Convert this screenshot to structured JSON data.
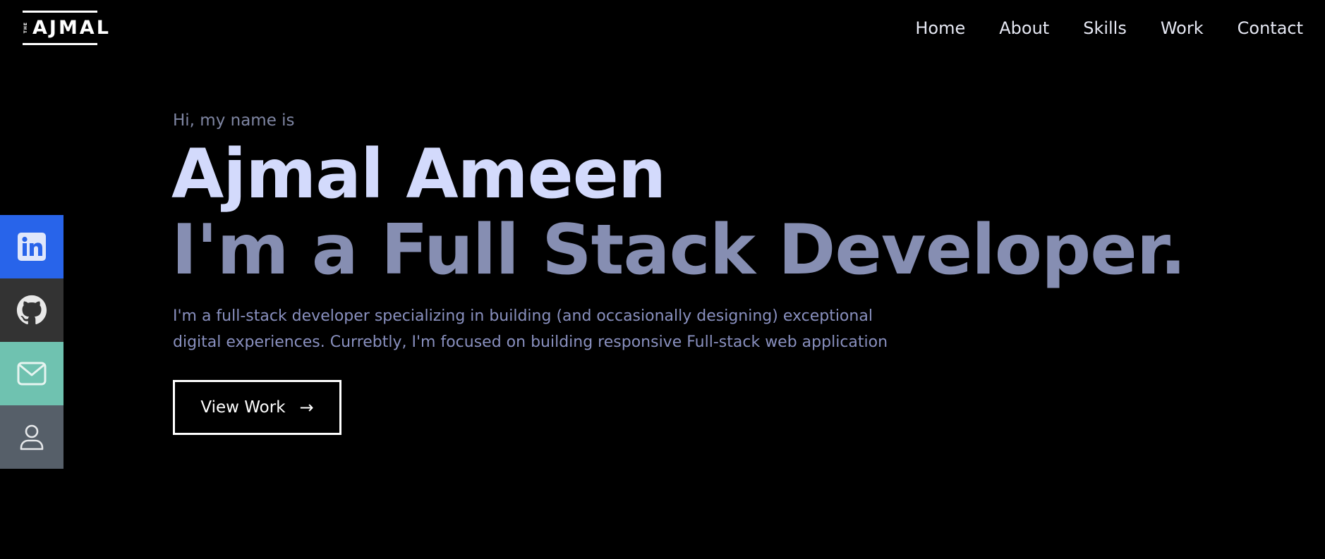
{
  "header": {
    "logo_small": "THE",
    "logo_main": "AJMAL",
    "nav": [
      {
        "label": "Home"
      },
      {
        "label": "About"
      },
      {
        "label": "Skills"
      },
      {
        "label": "Work"
      },
      {
        "label": "Contact"
      }
    ]
  },
  "social": {
    "items": [
      {
        "icon": "linkedin-icon",
        "color": "#2864ea"
      },
      {
        "icon": "github-icon",
        "color": "#333333"
      },
      {
        "icon": "mail-icon",
        "color": "#6fc2b0"
      },
      {
        "icon": "user-icon",
        "color": "#565f69"
      }
    ]
  },
  "hero": {
    "greeting": "Hi, my name is",
    "name": "Ajmal Ameen",
    "role": "I'm a Full Stack Developer.",
    "bio": "I'm a full-stack developer specializing in building (and occasionally designing) exceptional digital experiences. Currebtly, I'm focused on building responsive Full-stack web application",
    "cta_label": "View Work",
    "cta_arrow": "→"
  },
  "colors": {
    "background": "#000000",
    "name": "#d3dafc",
    "role": "#868eb2",
    "greeting": "#7f86a3",
    "bio": "#8990bf"
  }
}
